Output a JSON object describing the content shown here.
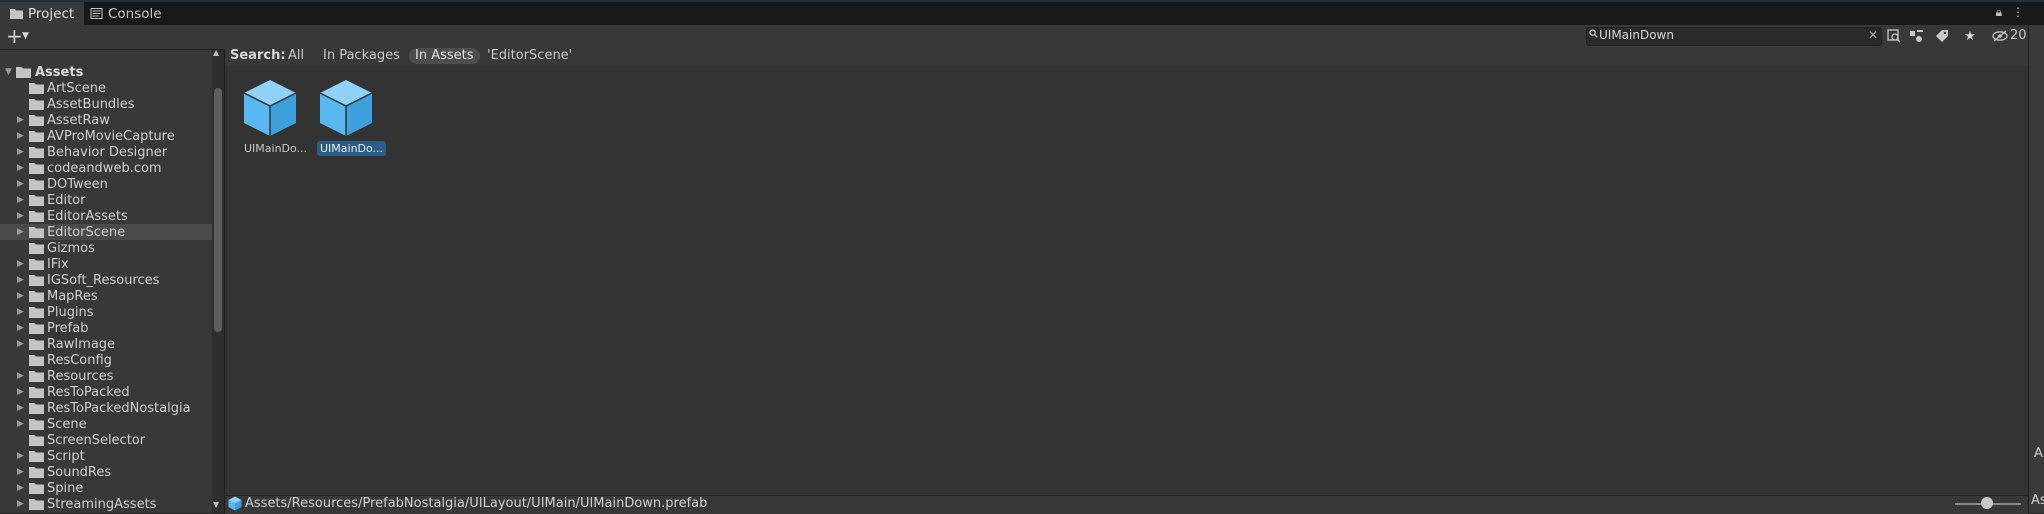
{
  "tabs": [
    {
      "label": "Project",
      "icon": "folder-icon",
      "active": true
    },
    {
      "label": "Console",
      "icon": "console-icon",
      "active": false
    }
  ],
  "toolbar": {
    "search_value": "UIMainDown",
    "hidden_count": "20"
  },
  "tree": {
    "root": "Assets",
    "items": [
      {
        "label": "ArtScene",
        "expandable": false
      },
      {
        "label": "AssetBundles",
        "expandable": false
      },
      {
        "label": "AssetRaw",
        "expandable": true
      },
      {
        "label": "AVProMovieCapture",
        "expandable": true
      },
      {
        "label": "Behavior Designer",
        "expandable": true
      },
      {
        "label": "codeandweb.com",
        "expandable": true
      },
      {
        "label": "DOTween",
        "expandable": true
      },
      {
        "label": "Editor",
        "expandable": true
      },
      {
        "label": "EditorAssets",
        "expandable": true
      },
      {
        "label": "EditorScene",
        "expandable": true,
        "selected": true
      },
      {
        "label": "Gizmos",
        "expandable": false
      },
      {
        "label": "IFix",
        "expandable": true
      },
      {
        "label": "IGSoft_Resources",
        "expandable": true
      },
      {
        "label": "MapRes",
        "expandable": true
      },
      {
        "label": "Plugins",
        "expandable": true
      },
      {
        "label": "Prefab",
        "expandable": true
      },
      {
        "label": "RawImage",
        "expandable": true
      },
      {
        "label": "ResConfig",
        "expandable": false
      },
      {
        "label": "Resources",
        "expandable": true
      },
      {
        "label": "ResToPacked",
        "expandable": true
      },
      {
        "label": "ResToPackedNostalgia",
        "expandable": true
      },
      {
        "label": "Scene",
        "expandable": true
      },
      {
        "label": "ScreenSelector",
        "expandable": false
      },
      {
        "label": "Script",
        "expandable": true
      },
      {
        "label": "SoundRes",
        "expandable": true
      },
      {
        "label": "Spine",
        "expandable": true
      },
      {
        "label": "StreamingAssets",
        "expandable": true
      }
    ]
  },
  "search_scope": {
    "label": "Search:",
    "options": [
      "All",
      "In Packages",
      "In Assets",
      "'EditorScene'"
    ],
    "selected": "In Assets"
  },
  "assets": [
    {
      "label": "UIMainDo...",
      "selected": false
    },
    {
      "label": "UIMainDo...",
      "selected": true
    }
  ],
  "status": {
    "path": "Assets/Resources/PrefabNostalgia/UILayout/UIMain/UIMainDown.prefab"
  },
  "right_edge": {
    "a1": "A",
    "a2": "As"
  },
  "colors": {
    "accent_selection": "#2c5d87",
    "prefab_icon": "#5ab8f0",
    "panel": "#383838",
    "background": "#282828"
  }
}
